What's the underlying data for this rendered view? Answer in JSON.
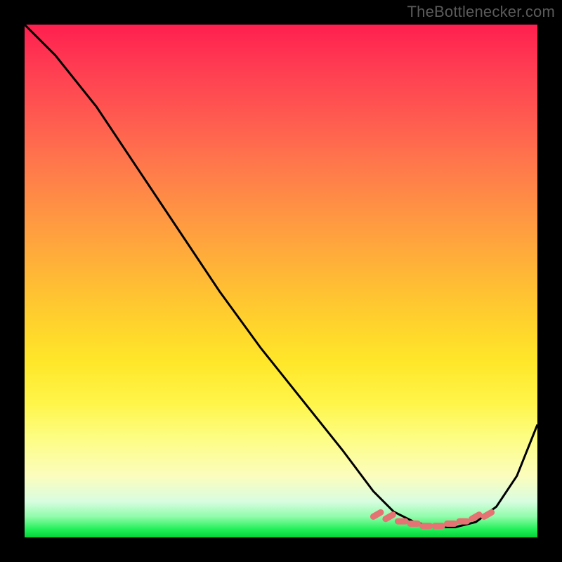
{
  "attribution": "TheBottlenecker.com",
  "chart_data": {
    "type": "line",
    "title": "",
    "xlabel": "",
    "ylabel": "",
    "xlim": [
      0,
      100
    ],
    "ylim": [
      0,
      100
    ],
    "x": [
      0,
      6,
      14,
      22,
      30,
      38,
      46,
      54,
      62,
      68,
      72,
      76,
      80,
      84,
      88,
      92,
      96,
      100
    ],
    "values": [
      100,
      94,
      84,
      72,
      60,
      48,
      37,
      27,
      17,
      9,
      5,
      3,
      2,
      2,
      3,
      6,
      12,
      22
    ],
    "trough_band_x": [
      68,
      92
    ],
    "trough_band_y": 2,
    "colors": {
      "curve": "#000000",
      "marker": "#e57373"
    }
  }
}
